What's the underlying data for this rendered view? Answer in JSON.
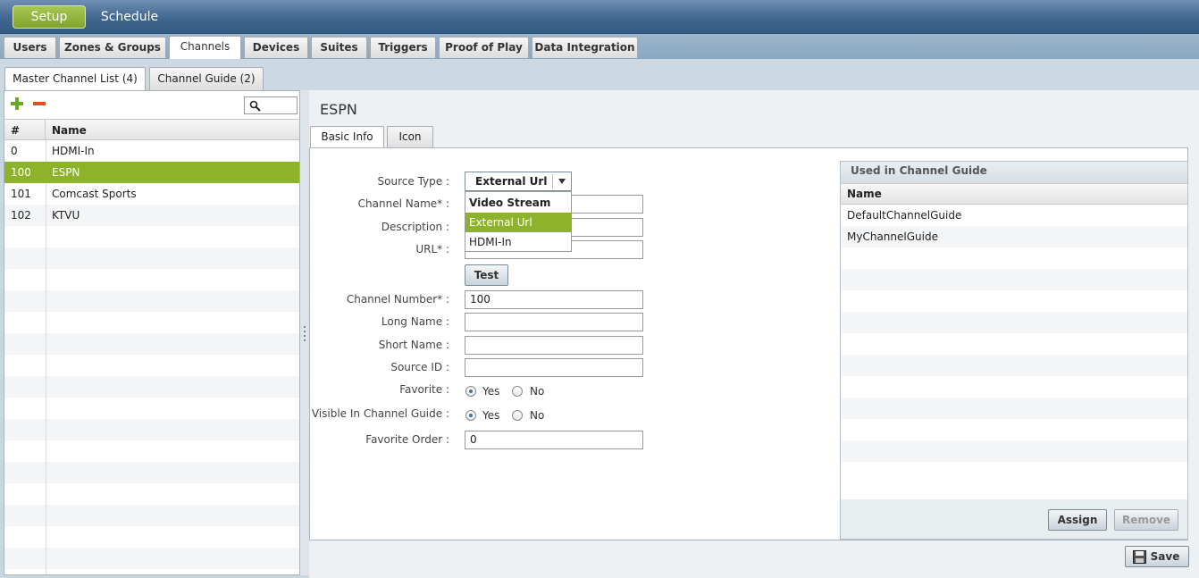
{
  "topnav": {
    "setup": "Setup",
    "schedule": "Schedule"
  },
  "subnav": [
    "Users",
    "Zones & Groups",
    "Channels",
    "Devices",
    "Suites",
    "Triggers",
    "Proof of Play",
    "Data Integration"
  ],
  "channel_tabs": {
    "master": "Master Channel List (4)",
    "guide": "Channel Guide (2)"
  },
  "channel_list": {
    "headers": {
      "num": "#",
      "name": "Name"
    },
    "rows": [
      {
        "num": "0",
        "name": "HDMI-In"
      },
      {
        "num": "100",
        "name": "ESPN"
      },
      {
        "num": "101",
        "name": "Comcast Sports"
      },
      {
        "num": "102",
        "name": "KTVU"
      }
    ]
  },
  "detail": {
    "title": "ESPN",
    "tabs": {
      "basic": "Basic Info",
      "icon": "Icon"
    },
    "labels": {
      "source_type": "Source Type :",
      "channel_name": "Channel Name* :",
      "description": "Description :",
      "url": "URL* :",
      "channel_number": "Channel Number* :",
      "long_name": "Long Name :",
      "short_name": "Short Name :",
      "source_id": "Source ID :",
      "favorite": "Favorite :",
      "visible": "Visible In Channel Guide :",
      "favorite_order": "Favorite Order :"
    },
    "source_type_value": "External Url",
    "source_options": [
      "Video Stream",
      "External Url",
      "HDMI-In"
    ],
    "test_button": "Test",
    "channel_number_value": "100",
    "favorite_order_value": "0",
    "yes": "Yes",
    "no": "No"
  },
  "guide_panel": {
    "title": "Used in Channel Guide",
    "header": "Name",
    "rows": [
      "DefaultChannelGuide",
      "MyChannelGuide"
    ],
    "assign": "Assign",
    "remove": "Remove"
  },
  "save_button": "Save",
  "colors": {
    "accent": "#8db22c",
    "topbar": "#3f6790"
  }
}
